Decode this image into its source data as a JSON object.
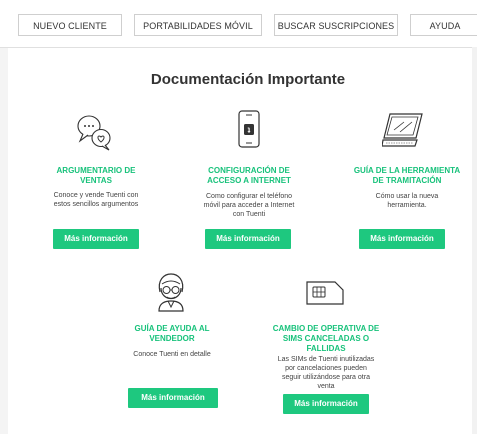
{
  "nav": {
    "items": [
      {
        "label": "NUEVO CLIENTE"
      },
      {
        "label": "PORTABILIDADES MÓVIL"
      },
      {
        "label": "BUSCAR SUSCRIPCIONES"
      },
      {
        "label": "AYUDA"
      }
    ]
  },
  "main": {
    "title": "Documentación Importante",
    "cards": [
      {
        "icon": "chat-bubbles-icon",
        "title_line1": "ARGUMENTARIO DE",
        "title_line2": "VENTAS",
        "desc_line1": "Conoce y vende Tuenti con",
        "desc_line2": "estos sencillos argumentos",
        "desc_line3": "",
        "button": "Más información"
      },
      {
        "icon": "smartphone-icon",
        "title_line1": "CONFIGURACIÓN DE",
        "title_line2": "ACCESO A INTERNET",
        "desc_line1": "Como configurar el teléfono",
        "desc_line2": "móvil para acceder a Internet",
        "desc_line3": "con Tuenti",
        "button": "Más información"
      },
      {
        "icon": "laptop-icon",
        "title_line1": "GUÍA DE LA HERRAMIENTA",
        "title_line2": "DE TRAMITACIÓN",
        "desc_line1": "Cómo usar la nueva",
        "desc_line2": "herramienta.",
        "desc_line3": "",
        "button": "Más información"
      },
      {
        "icon": "person-glasses-icon",
        "title_line1": "GUÍA DE AYUDA AL",
        "title_line2": "VENDEDOR",
        "desc_line1": "Conoce Tuenti en detalle",
        "desc_line2": "",
        "desc_line3": "",
        "button": "Más información"
      },
      {
        "icon": "sim-card-icon",
        "title_line1": "CAMBIO DE OPERATIVA DE",
        "title_line2": "SIMS CANCELADAS O",
        "title_line3": "FALLIDAS",
        "desc_line1": "Las SIMs de Tuenti inutilizadas",
        "desc_line2": "por cancelaciones pueden",
        "desc_line3": "seguir utilizándose para otra",
        "desc_line4": "venta",
        "button": "Más información"
      }
    ]
  },
  "colors": {
    "accent": "#1ec87f",
    "accent_text": "#18c27b"
  }
}
